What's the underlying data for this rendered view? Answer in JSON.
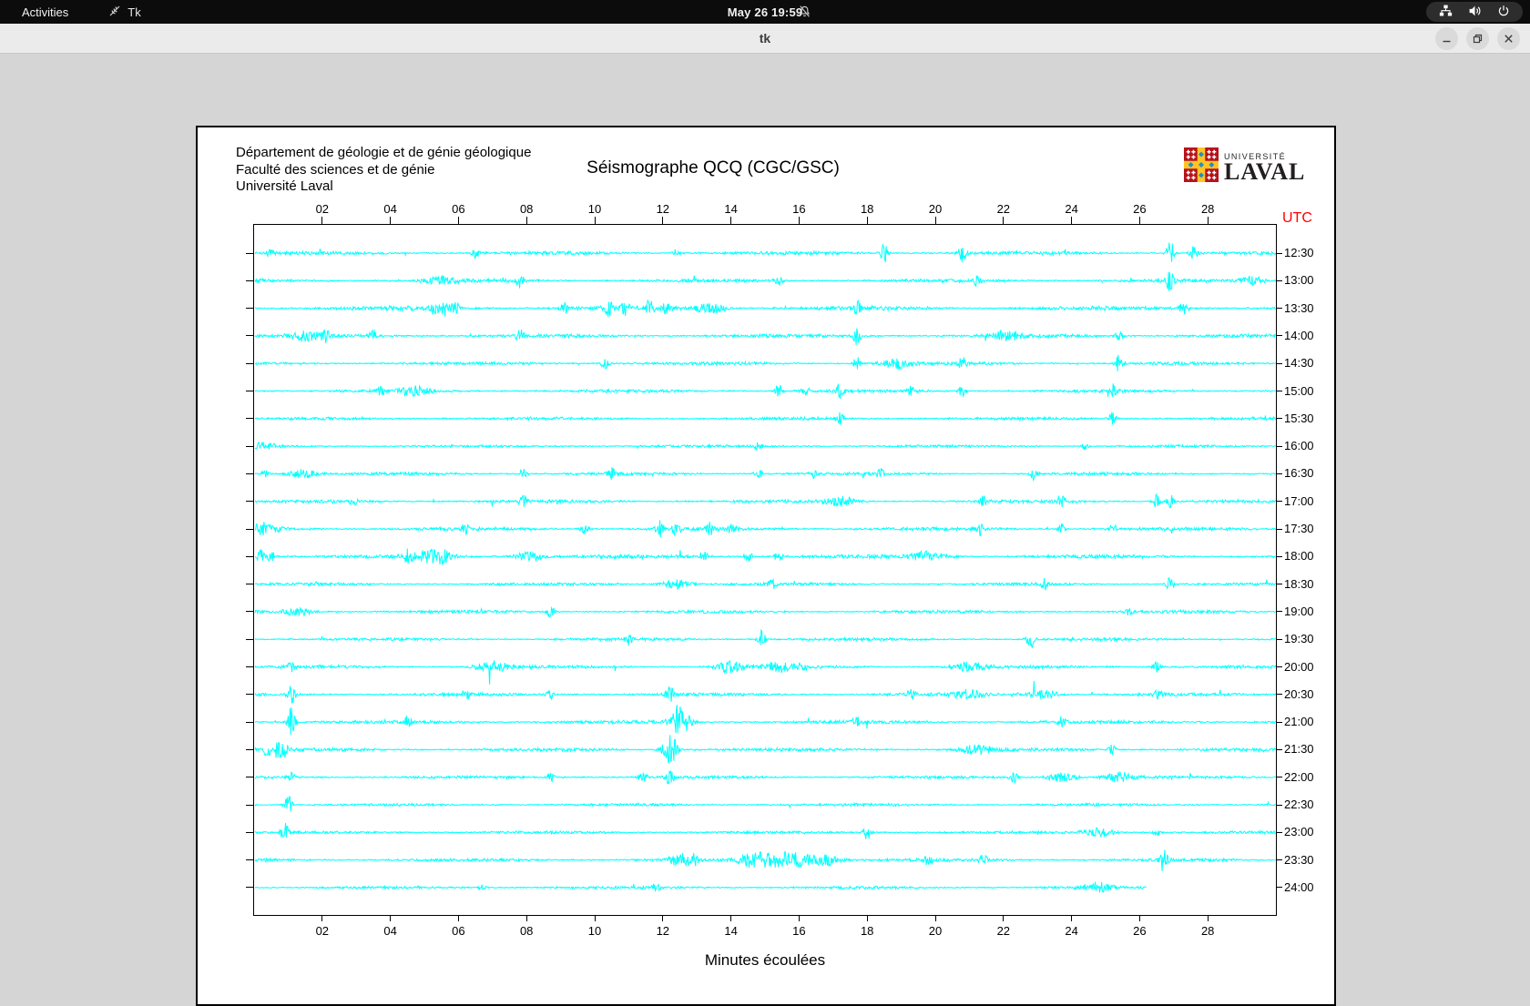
{
  "topbar": {
    "activities": "Activities",
    "app_name": "Tk",
    "clock": "May 26 19:59"
  },
  "titlebar": {
    "title": "tk"
  },
  "seismograph": {
    "org_lines": [
      "Département de géologie et de génie géologique",
      "Faculté des sciences et de génie",
      "Université Laval"
    ],
    "title": "Séismographe QCQ (CGC/GSC)",
    "logo": {
      "line1": "UNIVERSITÉ",
      "line2": "LAVAL"
    },
    "utc_label": "UTC",
    "xlabel": "Minutes écoulées",
    "colors": {
      "trace": "#00ffff",
      "utc_label": "#ff0000",
      "frame": "#000000"
    }
  },
  "chart_data": {
    "type": "line",
    "title": "Séismographe QCQ (CGC/GSC)",
    "xlabel": "Minutes écoulées",
    "x_range_minutes": [
      0,
      30
    ],
    "x_ticks": [
      "02",
      "04",
      "06",
      "08",
      "10",
      "12",
      "14",
      "16",
      "18",
      "20",
      "22",
      "24",
      "26",
      "28"
    ],
    "trace_color": "#00ffff",
    "rows": [
      {
        "utc": "12:30",
        "namp": 1.8,
        "end": 30,
        "events": [
          [
            0.5,
            4
          ],
          [
            6.5,
            5
          ],
          [
            12.4,
            4
          ],
          [
            18.5,
            10
          ],
          [
            20.8,
            11
          ],
          [
            26.9,
            13
          ],
          [
            27.6,
            8
          ]
        ]
      },
      {
        "utc": "13:00",
        "namp": 1.8,
        "end": 30,
        "events": [
          [
            5.5,
            4,
            0.3
          ],
          [
            7.8,
            8
          ],
          [
            15.4,
            7
          ],
          [
            21.2,
            4
          ],
          [
            26.9,
            12
          ],
          [
            29.3,
            5,
            0.25
          ]
        ]
      },
      {
        "utc": "13:30",
        "namp": 2.2,
        "end": 30,
        "events": [
          [
            5.3,
            9
          ],
          [
            5.6,
            10
          ],
          [
            5.9,
            8
          ],
          [
            9.1,
            6
          ],
          [
            10.4,
            9
          ],
          [
            10.9,
            8
          ],
          [
            11.6,
            9
          ],
          [
            12.1,
            7
          ],
          [
            13.4,
            6,
            0.3
          ],
          [
            17.7,
            7
          ],
          [
            27.3,
            10
          ]
        ]
      },
      {
        "utc": "14:00",
        "namp": 1.8,
        "end": 30,
        "events": [
          [
            1.5,
            5,
            0.3
          ],
          [
            2.1,
            6
          ],
          [
            3.5,
            7
          ],
          [
            7.8,
            7
          ],
          [
            17.7,
            10
          ],
          [
            22.1,
            5,
            0.3
          ],
          [
            25.4,
            6
          ]
        ]
      },
      {
        "utc": "14:30",
        "namp": 1.6,
        "end": 30,
        "events": [
          [
            10.3,
            6
          ],
          [
            17.7,
            7
          ],
          [
            18.9,
            6,
            0.3
          ],
          [
            20.8,
            6
          ],
          [
            25.4,
            10
          ]
        ]
      },
      {
        "utc": "15:00",
        "namp": 1.6,
        "end": 30,
        "events": [
          [
            3.7,
            6
          ],
          [
            4.7,
            5,
            0.3
          ],
          [
            15.4,
            7
          ],
          [
            16.2,
            6
          ],
          [
            17.2,
            7
          ],
          [
            19.3,
            6
          ],
          [
            20.8,
            7
          ],
          [
            25.2,
            7
          ]
        ]
      },
      {
        "utc": "15:30",
        "namp": 1.5,
        "end": 30,
        "events": [
          [
            17.2,
            7
          ],
          [
            25.2,
            8
          ]
        ]
      },
      {
        "utc": "16:00",
        "namp": 1.3,
        "end": 30,
        "events": [
          [
            0.3,
            4,
            0.3
          ],
          [
            14.8,
            4
          ],
          [
            24.4,
            4
          ]
        ]
      },
      {
        "utc": "16:30",
        "namp": 1.6,
        "end": 30,
        "events": [
          [
            0.3,
            5
          ],
          [
            1.4,
            5,
            0.3
          ],
          [
            7.9,
            6
          ],
          [
            10.5,
            6
          ],
          [
            14.8,
            6
          ],
          [
            16.4,
            6
          ],
          [
            18.4,
            6
          ],
          [
            22.9,
            7
          ]
        ]
      },
      {
        "utc": "17:00",
        "namp": 1.6,
        "end": 30,
        "events": [
          [
            2.9,
            6
          ],
          [
            7.9,
            7
          ],
          [
            17.2,
            5,
            0.3
          ],
          [
            21.4,
            6
          ],
          [
            23.7,
            7
          ],
          [
            26.5,
            7
          ],
          [
            26.9,
            7
          ]
        ]
      },
      {
        "utc": "17:30",
        "namp": 1.8,
        "end": 30,
        "events": [
          [
            0.3,
            6,
            0.3
          ],
          [
            6.2,
            6
          ],
          [
            9.7,
            6
          ],
          [
            11.9,
            9
          ],
          [
            12.4,
            8
          ],
          [
            13.4,
            6
          ],
          [
            14.0,
            6
          ],
          [
            21.3,
            6
          ],
          [
            23.7,
            6
          ],
          [
            25.2,
            6
          ]
        ]
      },
      {
        "utc": "18:00",
        "namp": 2.0,
        "end": 30,
        "events": [
          [
            0.2,
            7
          ],
          [
            0.5,
            6
          ],
          [
            4.5,
            6
          ],
          [
            5.2,
            7,
            0.35
          ],
          [
            5.6,
            7
          ],
          [
            8.1,
            6,
            0.3
          ],
          [
            13.2,
            6
          ],
          [
            14.5,
            7
          ],
          [
            15.4,
            7
          ],
          [
            19.8,
            5,
            0.35
          ]
        ]
      },
      {
        "utc": "18:30",
        "namp": 1.5,
        "end": 30,
        "events": [
          [
            12.4,
            5,
            0.3
          ],
          [
            15.2,
            6
          ],
          [
            23.2,
            6
          ],
          [
            26.9,
            10
          ]
        ]
      },
      {
        "utc": "19:00",
        "namp": 1.5,
        "end": 30,
        "events": [
          [
            1.3,
            4,
            0.3
          ],
          [
            8.7,
            7
          ],
          [
            25.7,
            4
          ]
        ]
      },
      {
        "utc": "19:30",
        "namp": 1.5,
        "end": 30,
        "events": [
          [
            11.0,
            6
          ],
          [
            14.9,
            10
          ],
          [
            22.8,
            10
          ]
        ]
      },
      {
        "utc": "20:00",
        "namp": 1.7,
        "end": 30,
        "events": [
          [
            1.1,
            5
          ],
          [
            7.0,
            5,
            0.35
          ],
          [
            14.0,
            7,
            0.25
          ],
          [
            15.4,
            5,
            0.3
          ],
          [
            16.1,
            5
          ],
          [
            21.0,
            5,
            0.3
          ],
          [
            26.5,
            6
          ]
        ]
      },
      {
        "utc": "20:30",
        "namp": 1.7,
        "end": 30,
        "events": [
          [
            1.1,
            10
          ],
          [
            6.2,
            6
          ],
          [
            8.7,
            6
          ],
          [
            12.2,
            10
          ],
          [
            19.3,
            6
          ],
          [
            21.0,
            5,
            0.3
          ],
          [
            23.2,
            5,
            0.3
          ],
          [
            26.5,
            10
          ]
        ]
      },
      {
        "utc": "21:00",
        "namp": 1.7,
        "end": 30,
        "events": [
          [
            1.1,
            18
          ],
          [
            4.5,
            6
          ],
          [
            12.5,
            20,
            0.18
          ],
          [
            17.7,
            6
          ],
          [
            23.7,
            5
          ]
        ]
      },
      {
        "utc": "21:30",
        "namp": 1.7,
        "end": 30,
        "events": [
          [
            0.4,
            9
          ],
          [
            0.7,
            10
          ],
          [
            0.9,
            8
          ],
          [
            12.2,
            19,
            0.15
          ],
          [
            21.2,
            5,
            0.3
          ],
          [
            25.2,
            6
          ]
        ]
      },
      {
        "utc": "22:00",
        "namp": 1.5,
        "end": 30,
        "events": [
          [
            1.1,
            5
          ],
          [
            8.7,
            5
          ],
          [
            11.4,
            6
          ],
          [
            12.2,
            12
          ],
          [
            22.3,
            6
          ],
          [
            23.7,
            5,
            0.3
          ],
          [
            25.4,
            5,
            0.3
          ]
        ]
      },
      {
        "utc": "22:30",
        "namp": 1.4,
        "end": 30,
        "events": [
          [
            1.0,
            11
          ]
        ]
      },
      {
        "utc": "23:00",
        "namp": 1.4,
        "end": 30,
        "events": [
          [
            0.9,
            10
          ],
          [
            18.0,
            10
          ],
          [
            24.8,
            5,
            0.3
          ],
          [
            26.5,
            5
          ]
        ]
      },
      {
        "utc": "23:30",
        "namp": 1.6,
        "end": 30,
        "events": [
          [
            12.5,
            7,
            0.2
          ],
          [
            12.9,
            7
          ],
          [
            14.6,
            6,
            0.3
          ],
          [
            15.3,
            7,
            0.4
          ],
          [
            16.0,
            7,
            0.3
          ],
          [
            16.8,
            6,
            0.3
          ],
          [
            19.8,
            6
          ],
          [
            21.4,
            6
          ],
          [
            26.7,
            13
          ]
        ]
      },
      {
        "utc": "24:00",
        "namp": 1.4,
        "end": 26.2,
        "events": [
          [
            6.7,
            4
          ],
          [
            11.8,
            4
          ],
          [
            24.8,
            5,
            0.3
          ]
        ]
      }
    ]
  }
}
